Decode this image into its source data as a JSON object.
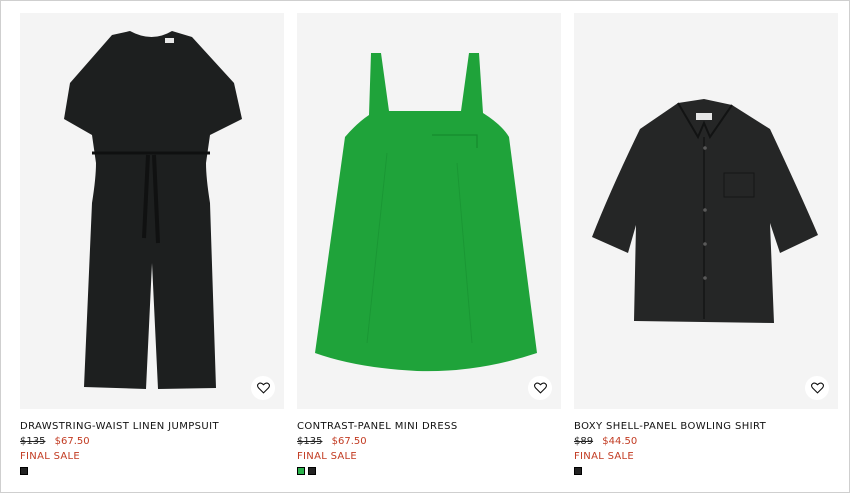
{
  "colors": {
    "sale_red": "#c23b22",
    "card_bg": "#f4f4f4"
  },
  "products": [
    {
      "title": "DRAWSTRING-WAIST LINEN JUMPSUIT",
      "was_price": "$135",
      "now_price": "$67.50",
      "badge": "FINAL SALE",
      "swatches": [
        "#222222"
      ],
      "garment_color": "#1d1f1f",
      "wishlist_icon": "heart-outline-icon"
    },
    {
      "title": "CONTRAST-PANEL MINI DRESS",
      "was_price": "$135",
      "now_price": "$67.50",
      "badge": "FINAL SALE",
      "swatches": [
        "#2bb24c",
        "#222222"
      ],
      "garment_color": "#1fa33a",
      "wishlist_icon": "heart-outline-icon"
    },
    {
      "title": "BOXY SHELL-PANEL BOWLING SHIRT",
      "was_price": "$89",
      "now_price": "$44.50",
      "badge": "FINAL SALE",
      "swatches": [
        "#222222"
      ],
      "garment_color": "#252626",
      "wishlist_icon": "heart-outline-icon"
    }
  ]
}
